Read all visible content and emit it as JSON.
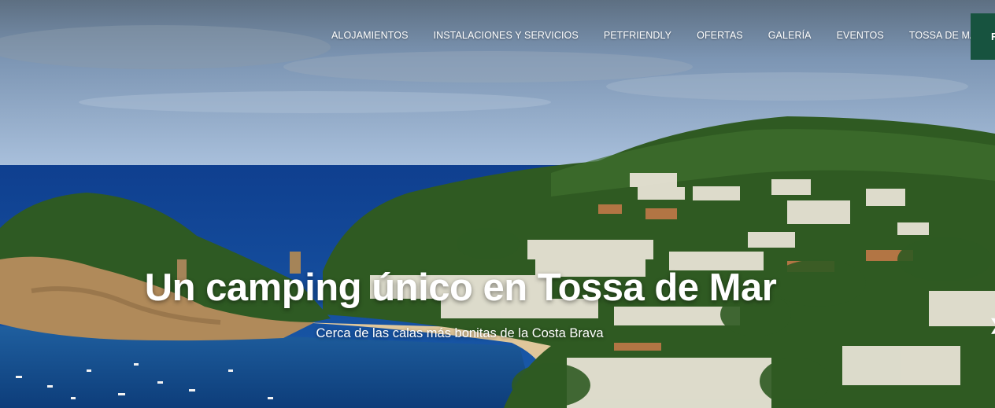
{
  "nav": {
    "items": [
      {
        "label": "ALOJAMIENTOS"
      },
      {
        "label": "INSTALACIONES Y SERVICIOS"
      },
      {
        "label": "PETFRIENDLY"
      },
      {
        "label": "OFERTAS"
      },
      {
        "label": "GALERÍA"
      },
      {
        "label": "EVENTOS"
      },
      {
        "label": "TOSSA DE MAR"
      }
    ],
    "cta_label": "R",
    "cta_color": "#17533f"
  },
  "hero": {
    "title": "Un camping único en Tossa de Mar",
    "subtitle": "Cerca de las calas más bonitas de la Costa Brava",
    "next_icon": "chevron-right-icon"
  },
  "colors": {
    "sky": "#7f9cbf",
    "sea": "#1450a0",
    "vegetation": "#2f5a22",
    "rock": "#b08a5a",
    "sand": "#e0c79b"
  }
}
